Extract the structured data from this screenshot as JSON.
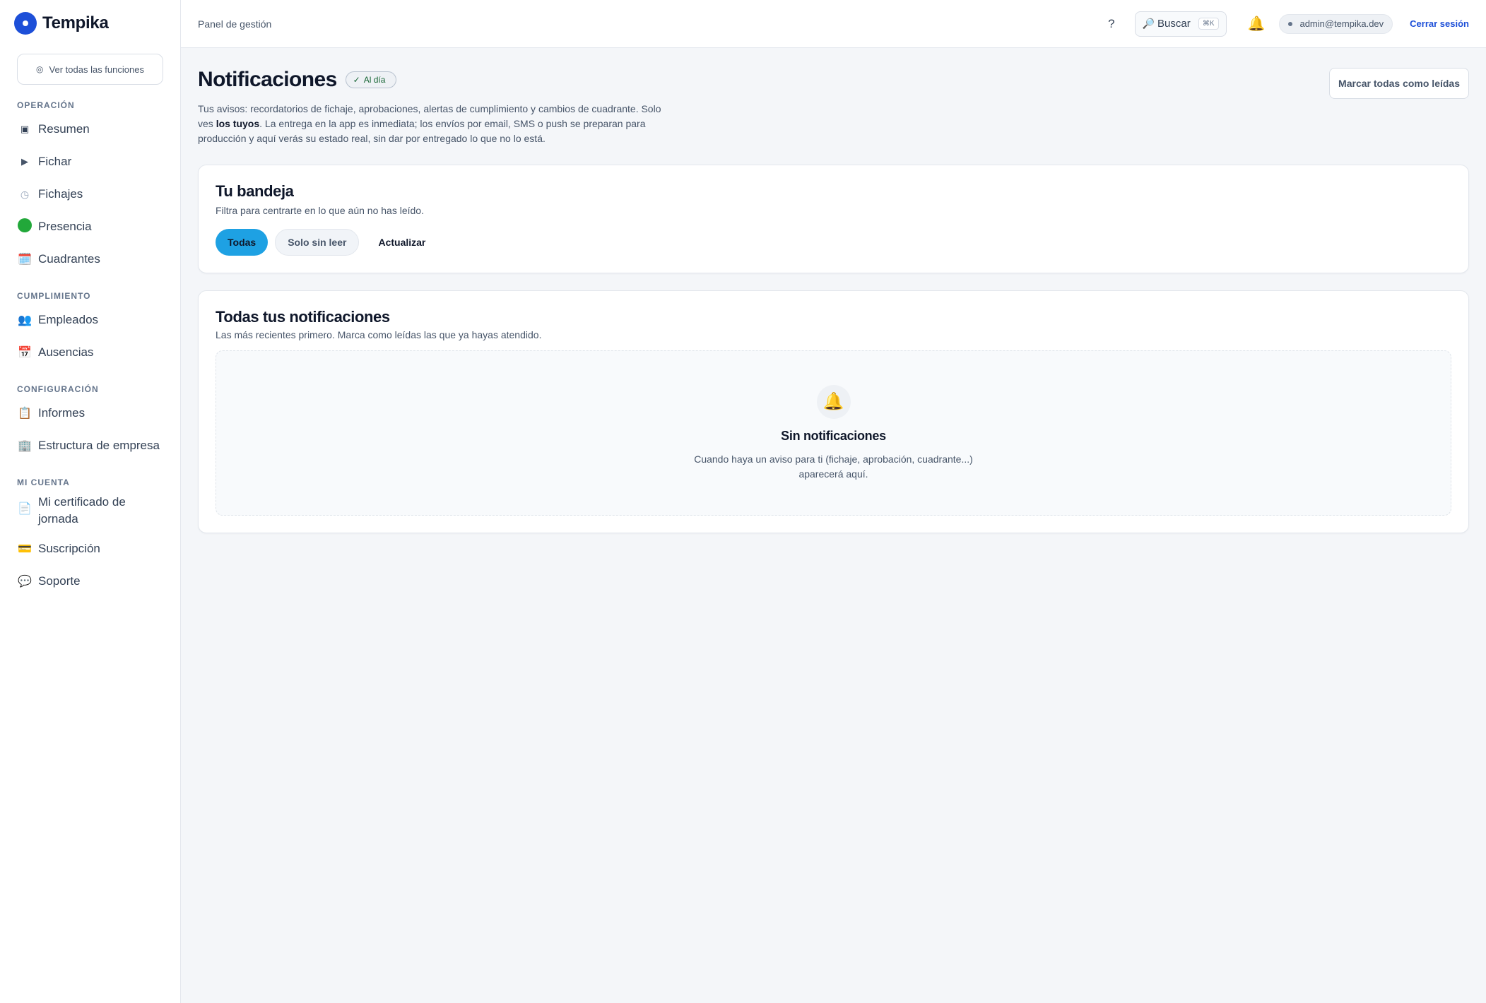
{
  "brand": {
    "name": "Tempika",
    "color": "#1d4fd8"
  },
  "sidebar": {
    "see_all": "Ver todas las funciones",
    "sections": [
      {
        "title": "OPERACIÓN",
        "items": [
          {
            "label": "Resumen",
            "icon": "square-icon"
          },
          {
            "label": "Fichar",
            "icon": "play-icon"
          },
          {
            "label": "Fichajes",
            "icon": "clock-icon"
          },
          {
            "label": "Presencia",
            "icon": "green-dot-icon"
          },
          {
            "label": "Cuadrantes",
            "icon": "calendar-icon"
          }
        ]
      },
      {
        "title": "CUMPLIMIENTO",
        "items": [
          {
            "label": "Empleados",
            "icon": "people-icon"
          },
          {
            "label": "Ausencias",
            "icon": "date-icon"
          }
        ]
      },
      {
        "title": "CONFIGURACIÓN",
        "items": [
          {
            "label": "Informes",
            "icon": "clipboard-icon"
          },
          {
            "label": "Estructura de empresa",
            "icon": "building-icon"
          }
        ]
      },
      {
        "title": "MI CUENTA",
        "items": [
          {
            "label": "Mi certificado de jornada",
            "icon": "document-icon"
          },
          {
            "label": "Suscripción",
            "icon": "credit-card-icon"
          },
          {
            "label": "Soporte",
            "icon": "speech-bubble-icon"
          }
        ]
      }
    ]
  },
  "topbar": {
    "breadcrumb": "Panel de gestión",
    "help": "?",
    "search_label": "Buscar",
    "search_shortcut": "⌘K",
    "user_email": "admin@tempika.dev",
    "logout": "Cerrar sesión"
  },
  "page": {
    "title": "Notificaciones",
    "badge": "Al día",
    "mark_all": "Marcar todas como leídas",
    "intro_1": "Tus avisos: recordatorios de fichaje, aprobaciones, alertas de cumplimiento y cambios de cuadrante. Solo ves ",
    "intro_bold": "los tuyos",
    "intro_2": ". La entrega en la app es inmediata; los envíos por email, SMS o push se preparan para producción y aquí verás su estado real, sin dar por entregado lo que no lo está."
  },
  "inbox": {
    "title": "Tu bandeja",
    "subtitle": "Filtra para centrarte en lo que aún no has leído.",
    "filters": {
      "all": "Todas",
      "unread": "Solo sin leer",
      "refresh": "Actualizar"
    },
    "active_color": "#1ea1e3"
  },
  "list": {
    "title": "Todas tus notificaciones",
    "subtitle": "Las más recientes primero. Marca como leídas las que ya hayas atendido.",
    "empty_title": "Sin notificaciones",
    "empty_text": "Cuando haya un aviso para ti (fichaje, aprobación, cuadrante...) aparecerá aquí."
  }
}
